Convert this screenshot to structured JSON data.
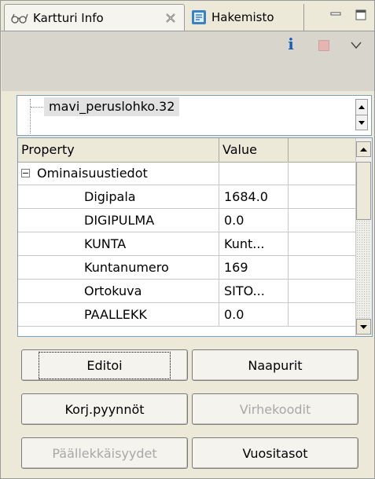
{
  "tabs": {
    "active_label": "Kartturi Info",
    "inactive_label": "Hakemisto"
  },
  "toolbar": {
    "info_label": "i"
  },
  "tree": {
    "node_label": "mavi_peruslohko.32"
  },
  "table": {
    "headers": [
      "Property",
      "Value",
      ""
    ],
    "group": "Ominaisuustiedot",
    "rows": [
      {
        "name": "Digipala",
        "value": "1684.0"
      },
      {
        "name": "DIGIPULMA",
        "value": "0.0"
      },
      {
        "name": "KUNTA",
        "value": "Kunt..."
      },
      {
        "name": "Kuntanumero",
        "value": "169"
      },
      {
        "name": "Ortokuva",
        "value": "SITO..."
      },
      {
        "name": "PAALLEKK",
        "value": "0.0"
      }
    ]
  },
  "buttons": {
    "editoi": "Editoi",
    "naapurit": "Naapurit",
    "korj": "Korj.pyynnöt",
    "virhe": "Virhekoodit",
    "paallekkaisyydet": "Päällekkäisyydet",
    "vuositasot": "Vuositasot"
  }
}
